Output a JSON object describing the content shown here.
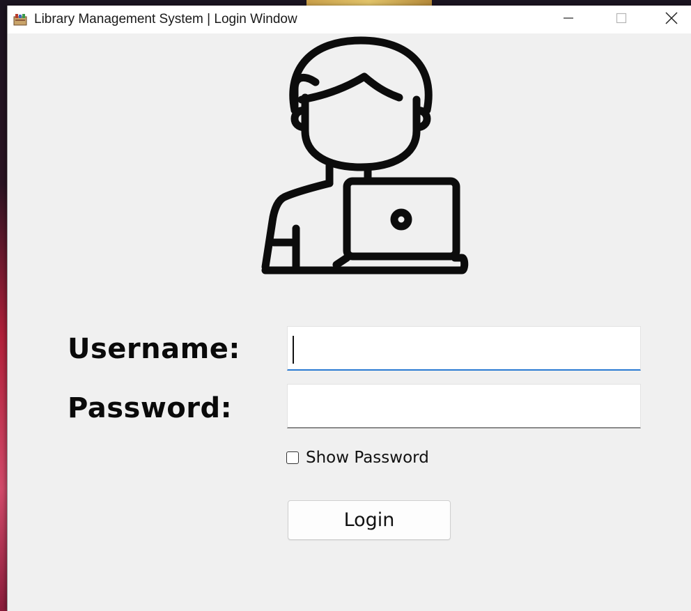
{
  "window": {
    "title": "Library Management System | Login Window",
    "icon": "app-books-icon",
    "controls": {
      "minimize": "minimize-icon",
      "maximize": "maximize-icon",
      "close": "close-icon"
    }
  },
  "illustration": {
    "icon": "user-with-laptop-icon"
  },
  "form": {
    "username_label": "Username:",
    "username_value": "",
    "password_label": "Password:",
    "password_value": "",
    "show_password_label": "Show Password",
    "show_password_checked": false,
    "login_label": "Login"
  },
  "colors": {
    "focus_accent": "#2a7ad2",
    "window_bg": "#f0f0f0"
  }
}
